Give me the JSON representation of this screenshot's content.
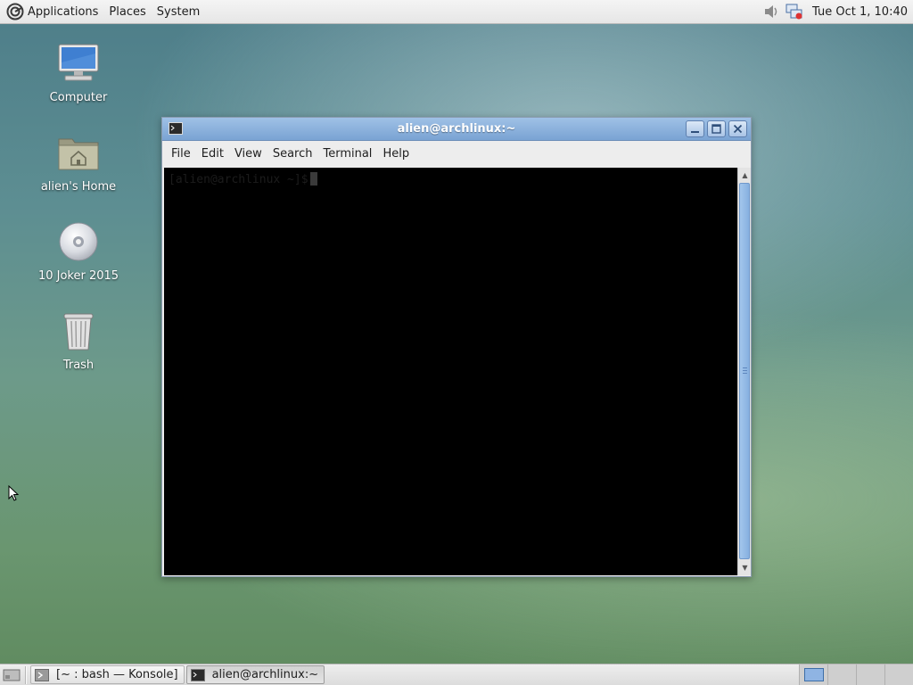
{
  "top_panel": {
    "menus": [
      "Applications",
      "Places",
      "System"
    ],
    "clock": "Tue Oct  1, 10:40",
    "tray_icons": [
      "volume-icon",
      "network-icon"
    ]
  },
  "desktop": {
    "icons": [
      {
        "label": "Computer",
        "icon": "computer-icon"
      },
      {
        "label": "alien's Home",
        "icon": "home-folder-icon"
      },
      {
        "label": "10 Joker 2015",
        "icon": "disc-icon"
      },
      {
        "label": "Trash",
        "icon": "trash-icon"
      }
    ]
  },
  "window": {
    "title": "alien@archlinux:~",
    "menu": [
      "File",
      "Edit",
      "View",
      "Search",
      "Terminal",
      "Help"
    ],
    "terminal": {
      "prompt": "[alien@archlinux ~]$"
    }
  },
  "taskbar": {
    "tasks": [
      {
        "label": "[~ : bash — Konsole]",
        "active": false
      },
      {
        "label": "alien@archlinux:~",
        "active": true
      }
    ],
    "workspaces": 4,
    "active_workspace": 1
  },
  "colors": {
    "titlebar": "#7aa3d3",
    "terminal_bg": "#000000",
    "scroll_thumb": "#87b1e0"
  }
}
